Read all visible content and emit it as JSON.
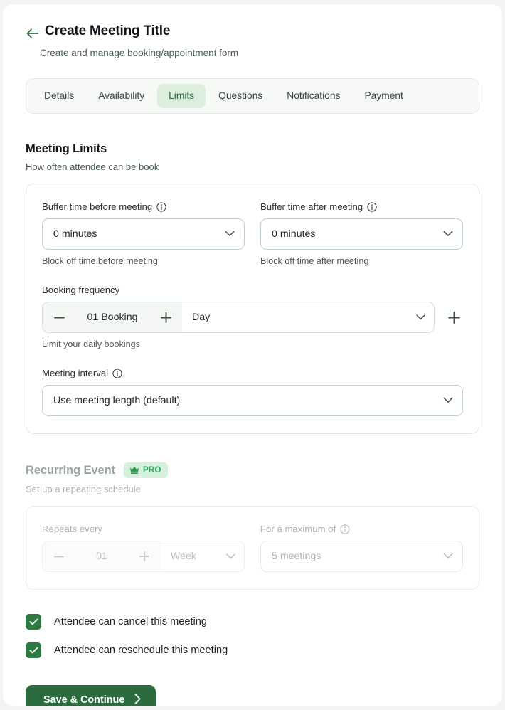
{
  "header": {
    "back_icon": "arrow-left-icon",
    "title": "Create Meeting Title",
    "subtitle": "Create and manage booking/appointment form"
  },
  "tabs": {
    "items": [
      {
        "label": "Details",
        "active": false
      },
      {
        "label": "Availability",
        "active": false
      },
      {
        "label": "Limits",
        "active": true
      },
      {
        "label": "Questions",
        "active": false
      },
      {
        "label": "Notifications",
        "active": false
      },
      {
        "label": "Payment",
        "active": false
      }
    ]
  },
  "meeting_limits": {
    "title": "Meeting Limits",
    "subtitle": "How often attendee can be book",
    "buffer_before": {
      "label": "Buffer time before meeting",
      "info_icon": "info-icon",
      "value": "0 minutes",
      "help": "Block off time before meeting"
    },
    "buffer_after": {
      "label": "Buffer time after meeting",
      "info_icon": "info-icon",
      "value": "0 minutes",
      "help": "Block off time after meeting"
    },
    "booking_frequency": {
      "label": "Booking frequency",
      "decrement": "−",
      "count": "01 Booking",
      "increment": "+",
      "period": "Day",
      "help": "Limit your daily bookings",
      "add_rule": "+"
    },
    "meeting_interval": {
      "label": "Meeting interval",
      "info_icon": "info-icon",
      "value": "Use meeting length (default)"
    }
  },
  "recurring_event": {
    "title": "Recurring Event",
    "badge": "PRO",
    "badge_icon": "crown-icon",
    "subtitle": "Set up a repeating schedule",
    "repeats_every": {
      "label": "Repeats every",
      "decrement": "−",
      "count": "01",
      "increment": "+",
      "period": "Week"
    },
    "maximum": {
      "label": "For a maximum of",
      "info_icon": "info-icon",
      "value": "5 meetings"
    }
  },
  "options": [
    {
      "label": "Attendee can cancel this meeting",
      "checked": true
    },
    {
      "label": "Attendee can reschedule this meeting",
      "checked": true
    }
  ],
  "footer": {
    "save_label": "Save & Continue",
    "save_icon": "chevron-right-icon"
  },
  "colors": {
    "brand_green": "#2c6b3d",
    "accent_green": "#2f9c56",
    "tab_active_bg": "#dcefdf",
    "pro_badge_bg": "#d5f0dd",
    "checkbox_green": "#2d7a43",
    "page_bg": "#f3f4f3"
  }
}
